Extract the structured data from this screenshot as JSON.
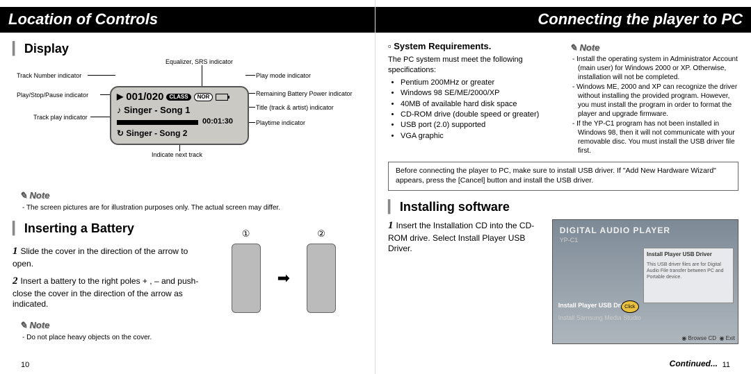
{
  "left_page": {
    "header": "Location of Controls",
    "display": {
      "title": "Display",
      "labels": {
        "track_number": "Track Number indicator",
        "play_stop_pause": "Play/Stop/Pause indicator",
        "track_play": "Track play indicator",
        "equalizer": "Equalizer, SRS indicator",
        "play_mode": "Play mode indicator",
        "remaining_battery": "Remaining Battery Power indicator",
        "title_track_artist": "Title (track & artist) indicator",
        "playtime": "Playtime indicator",
        "indicate_next": "Indicate next track"
      },
      "screen": {
        "counter": "001/020",
        "class_badge": "CLASS",
        "mode_badge": "NOR",
        "line2": "Singer - Song 1",
        "time": "00:01:30",
        "line3": "Singer - Song 2"
      },
      "note_label": "Note",
      "note_text": "The screen pictures are for illustration purposes only. The actual screen may differ."
    },
    "inserting": {
      "title": "Inserting a Battery",
      "steps": [
        "Slide the cover in the direction of the arrow to open.",
        "Insert a battery to the right poles + , – and push-close the cover in the direction of the arrow as indicated."
      ],
      "note_label": "Note",
      "note_text": "Do not place heavy objects on the cover."
    },
    "page_number": "10"
  },
  "right_page": {
    "header": "Connecting the player to PC",
    "sys_req": {
      "title": "System Requirements.",
      "intro": "The PC system must meet the following specifications:",
      "items": [
        "Pentium 200MHz or greater",
        "Windows 98 SE/ME/2000/XP",
        "40MB of available hard disk space",
        "CD-ROM drive (double speed or greater)",
        "USB port (2.0) supported",
        "VGA graphic"
      ]
    },
    "note_block": {
      "label": "Note",
      "items": [
        "Install the operating system in Administrator Account (main user) for Windows 2000 or XP. Otherwise, installation will not be completed.",
        "Windows ME, 2000 and XP can recognize the driver without installing the provided program. However, you must install the program in order to format the player and upgrade firmware.",
        "If the YP-C1 program has not been installed in Windows 98, then it will not communicate with your removable disc. You must install the USB driver file first."
      ]
    },
    "before_box": "Before connecting the player to PC, make sure to install USB driver. If \"Add New Hardware Wizard\" appears, press the [Cancel] button and install the USB driver.",
    "installing": {
      "title": "Installing software",
      "step_1": "Insert the Installation CD into the CD-ROM drive. Select Install Player USB Driver.",
      "dialog": {
        "brand_title": "DIGITAL AUDIO PLAYER",
        "model": "YP-C1",
        "panel_title": "Install Player USB Driver",
        "panel_text": "This USB driver files are for Digital Audio File transfer between PC and Portable device.",
        "menu_item_1": "Install Player USB Driver",
        "menu_item_2": "Install Samsung Media Studio",
        "click": "Click",
        "browse": "Browse CD",
        "exit": "Exit"
      }
    },
    "continued": "Continued...",
    "page_number": "11"
  }
}
